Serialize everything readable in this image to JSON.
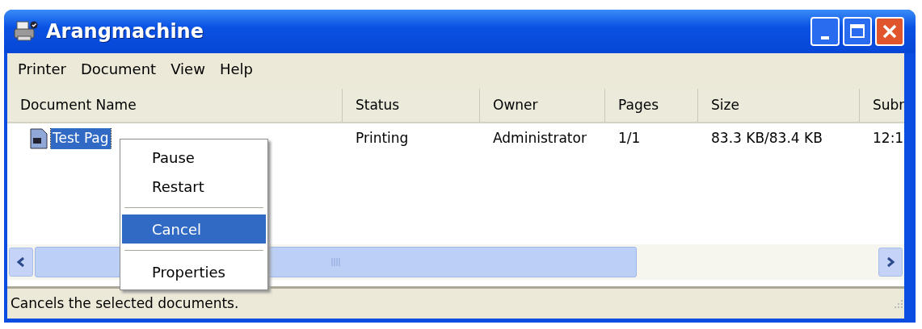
{
  "window": {
    "title": "Arangmachine"
  },
  "menu_bar": [
    "Printer",
    "Document",
    "View",
    "Help"
  ],
  "table": {
    "columns": [
      "Document Name",
      "Status",
      "Owner",
      "Pages",
      "Size",
      "Subr"
    ],
    "rows": [
      {
        "selected": true,
        "cells": [
          "Test Pag",
          "Printing",
          "Administrator",
          "1/1",
          "83.3 KB/83.4 KB",
          "12:1"
        ]
      }
    ]
  },
  "context_menu": [
    {
      "kind": "item",
      "label": "Pause",
      "selected": false
    },
    {
      "kind": "item",
      "label": "Restart",
      "selected": false
    },
    {
      "kind": "separator"
    },
    {
      "kind": "item",
      "label": "Cancel",
      "selected": true
    },
    {
      "kind": "separator"
    },
    {
      "kind": "item",
      "label": "Properties",
      "selected": false
    }
  ],
  "status_bar": "Cancels the selected documents."
}
